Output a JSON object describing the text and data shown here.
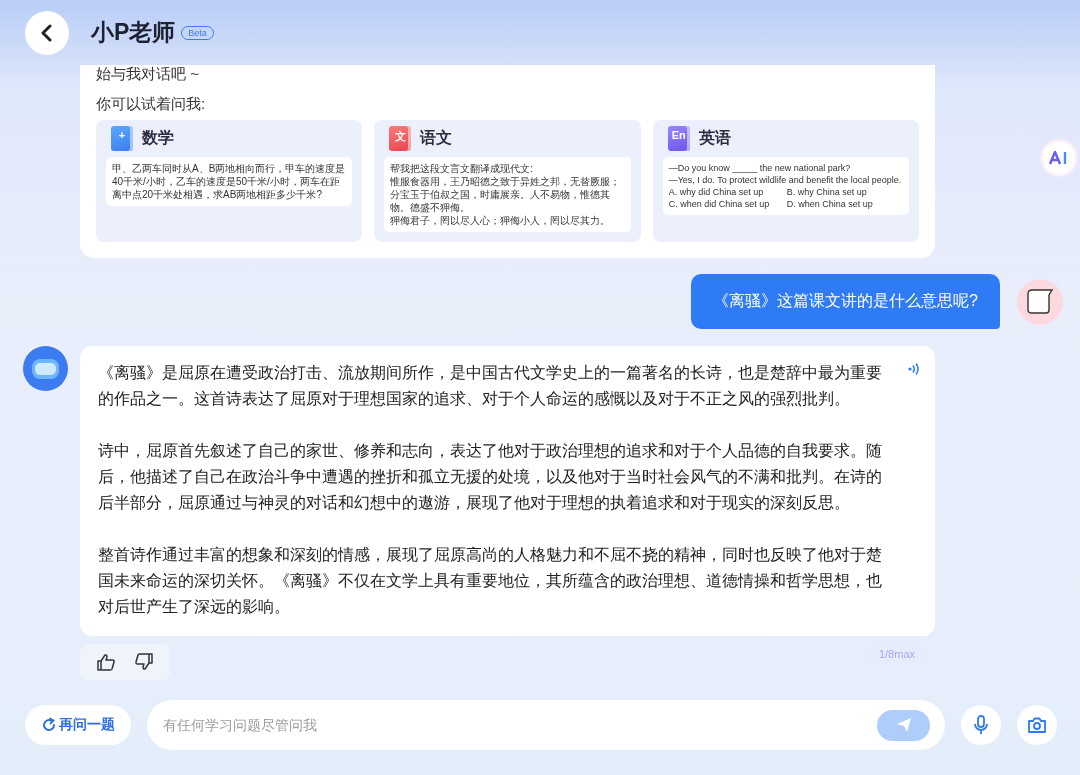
{
  "header": {
    "title": "小P老师",
    "badge": "Beta"
  },
  "intro": {
    "greeting": "始与我对话吧 ~",
    "prompt": "你可以试着问我:",
    "subjects": [
      {
        "kind": "math",
        "name": "数学",
        "icon_label": "+",
        "lines": [
          "甲、乙两车同时从A、B两地相向而行，甲车的速度是40千米/小时，乙车的速度是50千米/小时，两车在距离中点20千米处相遇，求AB两地相距多少千米?"
        ]
      },
      {
        "kind": "chinese",
        "name": "语文",
        "icon_label": "文",
        "lines": [
          "帮我把这段文言文翻译成现代文:",
          "惟服食器用，王乃昭德之致于异姓之邦，无替厥服；分宝玉于伯叔之国，时庸展亲。人不易物，惟德其物。德盛不狎侮。",
          "狎侮君子，罔以尽人心；狎侮小人，罔以尽其力。"
        ]
      },
      {
        "kind": "english",
        "name": "英语",
        "icon_label": "En",
        "lines": [
          "—Do you know _____ the new national park?",
          "—Yes, I do. To protect wildlife and benefit the local people."
        ],
        "options": [
          "A. why did China set up",
          "B. why China set up",
          "C. when did China set up",
          "D. when China set up"
        ]
      }
    ]
  },
  "messages": [
    {
      "kind": "user",
      "text": "《离骚》这篇课文讲的是什么意思呢?"
    },
    {
      "kind": "assistant",
      "paragraphs": [
        "《离骚》是屈原在遭受政治打击、流放期间所作，是中国古代文学史上的一篇著名的长诗，也是楚辞中最为重要的作品之一。这首诗表达了屈原对于理想国家的追求、对于个人命运的感慨以及对于不正之风的强烈批判。",
        "诗中，屈原首先叙述了自己的家世、修养和志向，表达了他对于政治理想的追求和对于个人品德的自我要求。随后，他描述了自己在政治斗争中遭遇的挫折和孤立无援的处境，以及他对于当时社会风气的不满和批判。在诗的后半部分，屈原通过与神灵的对话和幻想中的遨游，展现了他对于理想的执着追求和对于现实的深刻反思。",
        "整首诗作通过丰富的想象和深刻的情感，展现了屈原高尚的人格魅力和不屈不挠的精神，同时也反映了他对于楚国未来命运的深切关怀。《离骚》不仅在文学上具有重要地位，其所蕴含的政治理想、道德情操和哲学思想，也对后世产生了深远的影响。"
      ],
      "counter": "1/8max"
    }
  ],
  "bottom": {
    "retry_button": "再问一题",
    "input": {
      "placeholder": "有任何学习问题尽管问我"
    }
  }
}
